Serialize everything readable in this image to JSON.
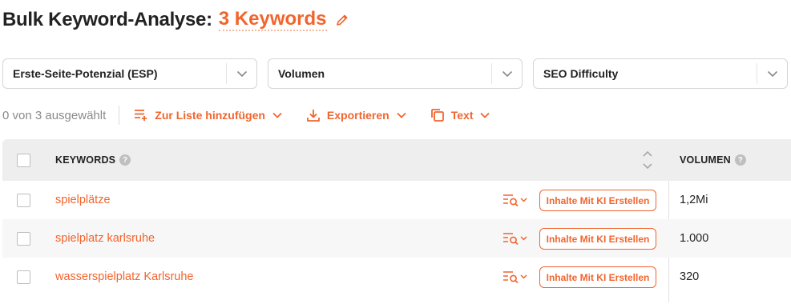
{
  "header": {
    "title": "Bulk Keyword-Analyse:",
    "count_link": "3 Keywords"
  },
  "filters": [
    {
      "label": "Erste-Seite-Potenzial (ESP)"
    },
    {
      "label": "Volumen"
    },
    {
      "label": "SEO Difficulty"
    }
  ],
  "toolbar": {
    "selected_text": "0 von 3 ausgewählt",
    "add_to_list": "Zur Liste hinzufügen",
    "export": "Exportieren",
    "text": "Text"
  },
  "table": {
    "columns": {
      "keywords": "KEYWORDS",
      "volume": "VOLUMEN",
      "help": "?"
    },
    "rows": [
      {
        "keyword": "spielplätze",
        "action": "Inhalte Mit KI Erstellen",
        "volume": "1,2Mi"
      },
      {
        "keyword": "spielplatz karlsruhe",
        "action": "Inhalte Mit KI Erstellen",
        "volume": "1.000"
      },
      {
        "keyword": "wasserspielplatz Karlsruhe",
        "action": "Inhalte Mit KI Erstellen",
        "volume": "320"
      }
    ]
  },
  "colors": {
    "accent": "#f2642d",
    "header_bg": "#eeeeee",
    "row_alt_bg": "#f7f7f7"
  },
  "icons": [
    "pencil-icon",
    "chevron-down-icon",
    "list-add-icon",
    "download-icon",
    "copy-icon",
    "help-icon",
    "sort-icon",
    "serp-search-icon"
  ]
}
